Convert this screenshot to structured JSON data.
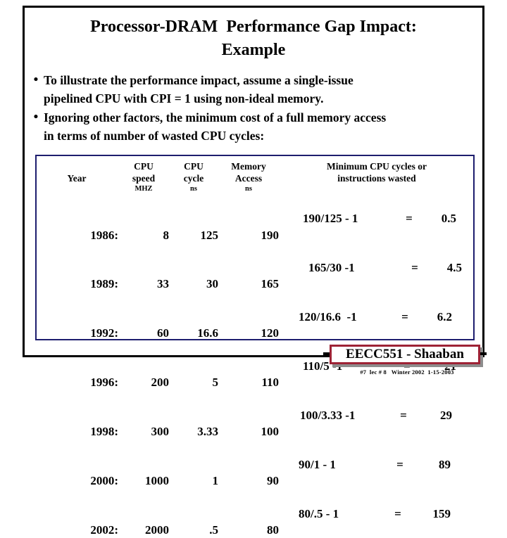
{
  "slide": {
    "title_line1": "Processor-DRAM  Performance Gap Impact:",
    "title_line2": "Example",
    "bullet_marker": "•",
    "bullets": [
      {
        "line1": "To illustrate the performance impact, assume a single-issue",
        "line2": "pipelined  CPU with CPI = 1  using non-ideal memory."
      },
      {
        "line1": "Ignoring other factors, the minimum cost of a full memory access",
        "line2": "in terms of number of wasted CPU cycles:"
      }
    ]
  },
  "table": {
    "headers": {
      "year": "Year",
      "cpu_speed_l1": "CPU",
      "cpu_speed_l2": "speed",
      "cpu_speed_l3": "MHZ",
      "cpu_cycle_l1": "CPU",
      "cpu_cycle_l2": "cycle",
      "cpu_cycle_l3": "ns",
      "memory_l1": "Memory",
      "memory_l2": "Access",
      "memory_l3": "ns",
      "wasted_l1": "Minimum CPU cycles  or",
      "wasted_l2": "instructions wasted"
    },
    "rows": [
      {
        "year": "1986:",
        "speed": "8",
        "cycle": "125",
        "memory": "190",
        "expr": "190/125 - 1",
        "eq": "=",
        "result": "0.5"
      },
      {
        "year": "1989:",
        "speed": "33",
        "cycle": "30",
        "memory": "165",
        "expr": "165/30 -1",
        "eq": "=",
        "result": "4.5"
      },
      {
        "year": "1992:",
        "speed": "60",
        "cycle": "16.6",
        "memory": "120",
        "expr": "120/16.6  -1",
        "eq": "=",
        "result": "6.2"
      },
      {
        "year": "1996:",
        "speed": "200",
        "cycle": "5",
        "memory": "110",
        "expr": "110/5 -1",
        "eq": "=",
        "result": "21"
      },
      {
        "year": "1998:",
        "speed": "300",
        "cycle": "3.33",
        "memory": "100",
        "expr": "100/3.33 -1",
        "eq": "=",
        "result": "29"
      },
      {
        "year": "2000:",
        "speed": "1000",
        "cycle": "1",
        "memory": "90",
        "expr": "90/1 - 1",
        "eq": "=",
        "result": "89"
      },
      {
        "year": "2002:",
        "speed": "2000",
        "cycle": ".5",
        "memory": "80",
        "expr": "80/.5 - 1",
        "eq": "=",
        "result": "159"
      }
    ]
  },
  "footer": {
    "banner_text": "EECC551 - Shaaban",
    "note": "#7  lec # 8   Winter 2002  1-15-2003"
  },
  "colors": {
    "frame_black": "#000000",
    "table_border_blue": "#1d1d6e",
    "banner_red": "#9e2235",
    "banner_shadow": "#8d8d8d",
    "background": "#ffffff"
  }
}
